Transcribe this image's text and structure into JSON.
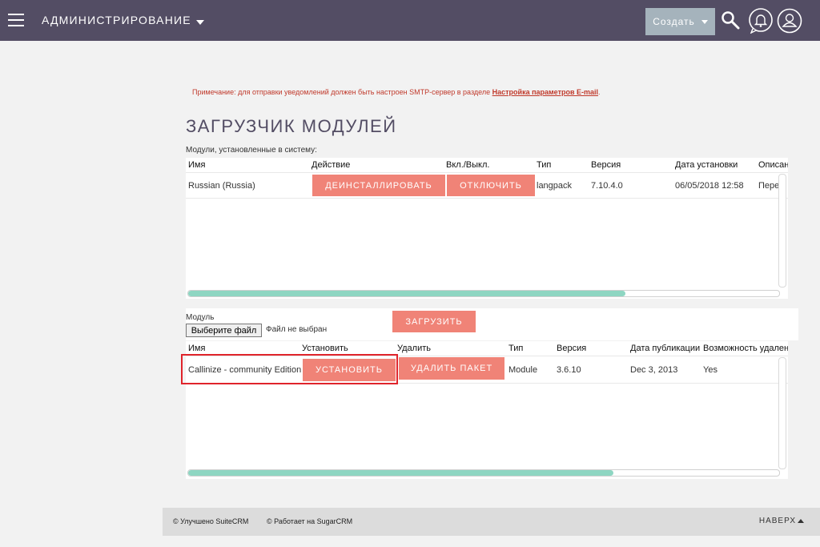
{
  "header": {
    "admin_label": "АДМИНИСТРИРОВАНИЕ",
    "create_label": "Создать"
  },
  "note": {
    "text": "Примечание: для отправки уведомлений должен быть настроен SMTP-сервер в разделе",
    "link_text": "Настройка параметров E-mail",
    "suffix": "."
  },
  "page_title": "ЗАГРУЗЧИК МОДУЛЕЙ",
  "installed": {
    "label": "Модули, установленные в систему:",
    "columns": [
      "Имя",
      "Действие",
      "Вкл./Выкл.",
      "Тип",
      "Версия",
      "Дата установки",
      "Описан"
    ],
    "row": {
      "name": "Russian (Russia)",
      "uninstall_label": "ДЕИНСТАЛЛИРОВАТЬ",
      "disable_label": "ОТКЛЮЧИТЬ",
      "type": "langpack",
      "version": "7.10.4.0",
      "date": "06/05/2018 12:58",
      "description": "Пере"
    },
    "scroll_fraction": 0.74
  },
  "upload": {
    "module_label": "Модуль",
    "choose_label": "Выберите файл",
    "no_file_label": "Файл не выбран",
    "upload_label": "ЗАГРУЗИТЬ"
  },
  "packages": {
    "columns": [
      "Имя",
      "Установить",
      "Удалить",
      "Тип",
      "Версия",
      "Дата публикации",
      "Возможность удален"
    ],
    "row": {
      "name": "Callinize - community Edition",
      "install_label": "УСТАНОВИТЬ",
      "delete_label": "УДАЛИТЬ ПАКЕТ",
      "type": "Module",
      "version": "3.6.10",
      "date": "Dec 3, 2013",
      "removable": "Yes"
    },
    "scroll_fraction": 0.72
  },
  "footer": {
    "improved": "© Улучшено SuiteCRM",
    "powered": "© Работает на SugarCRM",
    "top_label": "НАВЕРХ"
  },
  "colors": {
    "topbar": "#534d64",
    "accent": "#f08377",
    "highlight": "#e0242b",
    "scroll_thumb": "#8ed6c2"
  }
}
